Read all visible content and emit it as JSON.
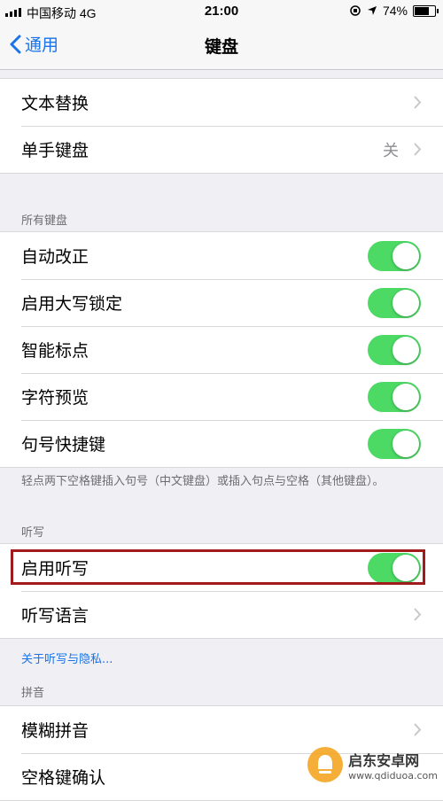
{
  "status": {
    "carrier": "中国移动 4G",
    "time": "21:00",
    "battery_text": "74%",
    "battery_level": 0.74
  },
  "nav": {
    "back_label": "通用",
    "title": "键盘"
  },
  "group1": {
    "items": [
      {
        "label": "文本替换",
        "value": ""
      },
      {
        "label": "单手键盘",
        "value": "关"
      }
    ]
  },
  "all_keyboards": {
    "header": "所有键盘",
    "items": [
      {
        "label": "自动改正",
        "on": true
      },
      {
        "label": "启用大写锁定",
        "on": true
      },
      {
        "label": "智能标点",
        "on": true
      },
      {
        "label": "字符预览",
        "on": true
      },
      {
        "label": "句号快捷键",
        "on": true
      }
    ],
    "footer": "轻点两下空格键插入句号（中文键盘）或插入句点与空格（其他键盘）。"
  },
  "dictation": {
    "header": "听写",
    "enable_label": "启用听写",
    "enable_on": true,
    "language_label": "听写语言",
    "privacy_link": "关于听写与隐私..."
  },
  "pinyin": {
    "header": "拼音",
    "items": [
      {
        "label": "模糊拼音"
      },
      {
        "label": "空格键确认"
      }
    ]
  },
  "watermark": {
    "name": "启东安卓网",
    "url": "www.qdiduoa.com"
  },
  "colors": {
    "accent": "#1a73e8",
    "toggle_on": "#4cd964",
    "highlight": "#a01c1c"
  }
}
